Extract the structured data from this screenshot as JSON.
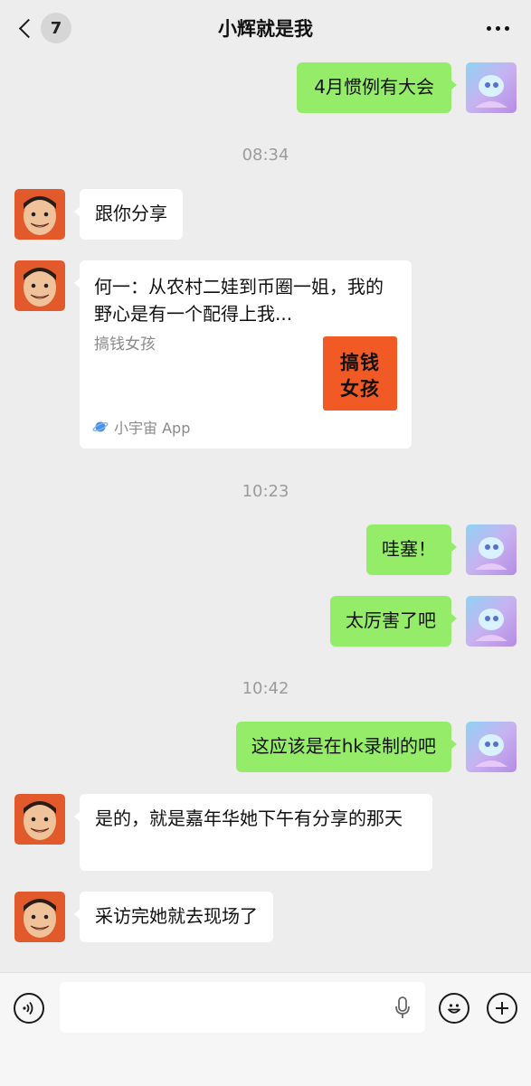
{
  "header": {
    "back_badge": "7",
    "title": "小辉就是我"
  },
  "colors": {
    "self_bubble": "#95ec69",
    "other_bubble": "#ffffff",
    "background": "#ededed",
    "card_thumb": "#f15a24"
  },
  "messages": {
    "m1": {
      "text": "4月惯例有大会",
      "from": "me"
    },
    "t1": "08:34",
    "m2": {
      "text": "跟你分享",
      "from": "other"
    },
    "card": {
      "title": "何一：从农村二娃到币圈一姐，我的野心是有一个配得上我...",
      "desc": "搞钱女孩",
      "thumb_line1": "搞钱",
      "thumb_line2": "女孩",
      "source": "小宇宙 App",
      "source_icon": "planet-icon"
    },
    "t2": "10:23",
    "m3": {
      "text": "哇塞！",
      "from": "me"
    },
    "m4": {
      "text": "太厉害了吧",
      "from": "me"
    },
    "t3": "10:42",
    "m5": {
      "text": "这应该是在hk录制的吧",
      "from": "me"
    },
    "m6": {
      "text": "是的，就是嘉年华她下午有分享的那天",
      "from": "other"
    },
    "m7": {
      "text": "采访完她就去现场了",
      "from": "other"
    }
  },
  "input_bar": {
    "voice_icon": "voice-icon",
    "mic_icon": "mic-icon",
    "emoji_icon": "emoji-icon",
    "plus_icon": "plus-icon",
    "input_value": ""
  }
}
